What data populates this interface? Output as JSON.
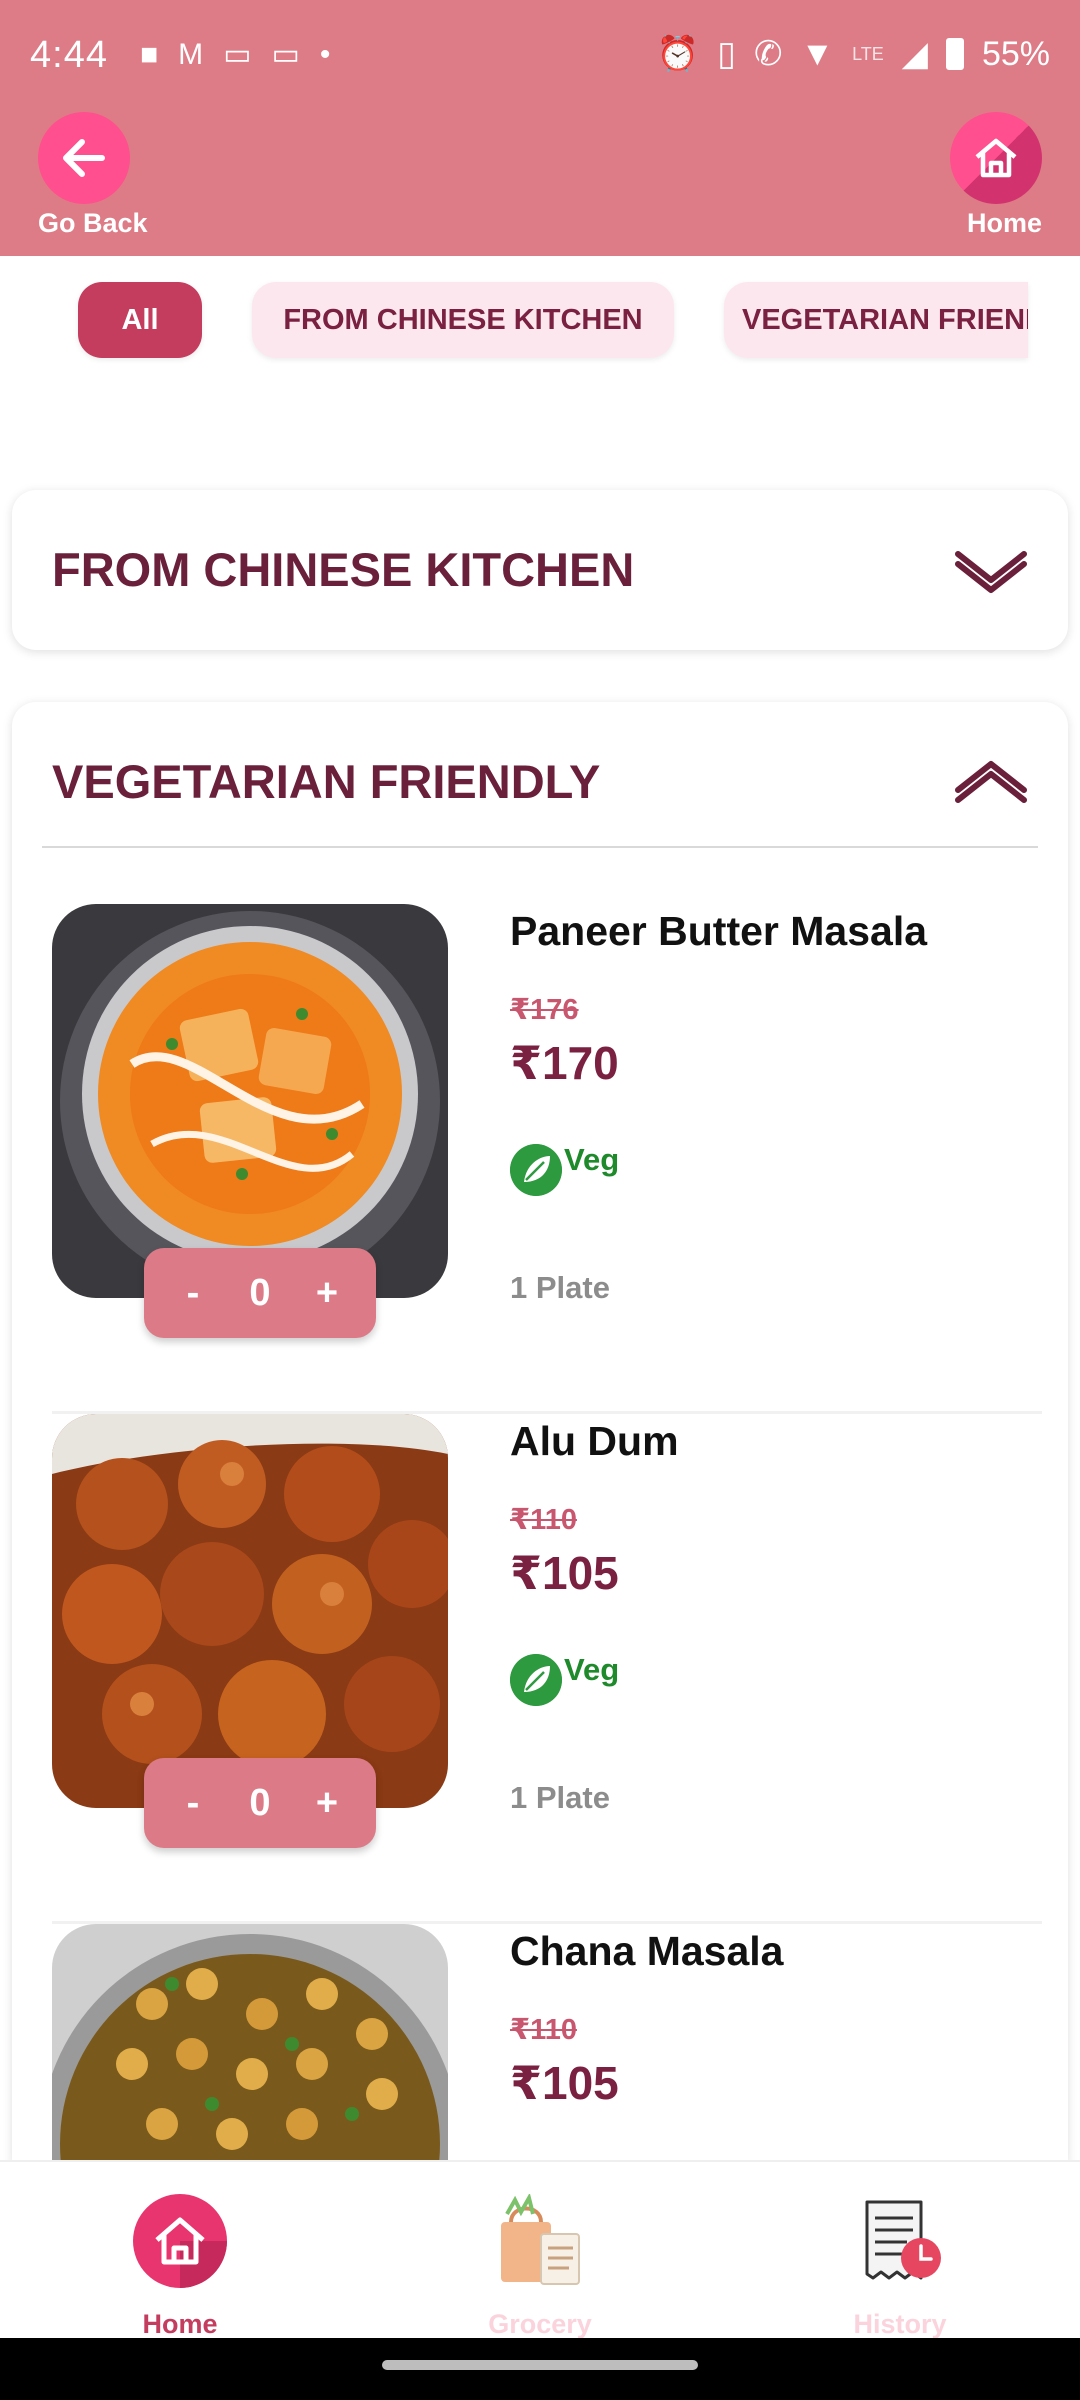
{
  "status_bar": {
    "time": "4:44",
    "battery": "55%",
    "network": "LTE"
  },
  "header": {
    "back_label": "Go Back",
    "home_label": "Home",
    "accent_color": "#dd7c86"
  },
  "chips": [
    {
      "label": "All",
      "active": true
    },
    {
      "label": "FROM CHINESE KITCHEN",
      "active": false
    },
    {
      "label": "VEGETARIAN FRIENDLY",
      "active": false
    }
  ],
  "sections": {
    "chinese": {
      "title": "FROM CHINESE KITCHEN",
      "expanded": false
    },
    "vegetarian": {
      "title": "VEGETARIAN FRIENDLY",
      "expanded": true
    }
  },
  "items": [
    {
      "name": "Paneer Butter Masala",
      "old_price": "₹176",
      "price": "₹170",
      "tag": "Veg",
      "quantity_unit": "1 Plate",
      "count": "0",
      "minus": "-",
      "plus": "+"
    },
    {
      "name": "Alu Dum",
      "old_price": "₹110",
      "price": "₹105",
      "tag": "Veg",
      "quantity_unit": "1 Plate",
      "count": "0",
      "minus": "-",
      "plus": "+"
    },
    {
      "name": "Chana Masala",
      "old_price": "₹110",
      "price": "₹105"
    }
  ],
  "bottom_nav": {
    "home": "Home",
    "grocery": "Grocery",
    "history": "History"
  }
}
